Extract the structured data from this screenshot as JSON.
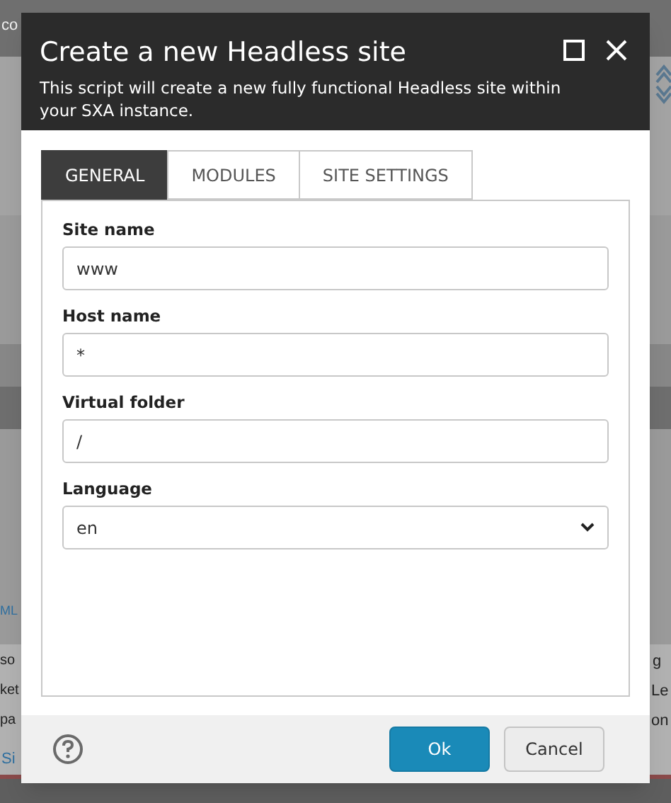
{
  "background": {
    "fragments": [
      {
        "text": "co",
        "kind": "header"
      },
      {
        "text": "ML",
        "kind": "link"
      },
      {
        "text": "so",
        "kind": "left"
      },
      {
        "text": "ket",
        "kind": "left"
      },
      {
        "text": "pa",
        "kind": "left"
      },
      {
        "text": "Si",
        "kind": "link-left"
      },
      {
        "text": "g",
        "kind": "right"
      },
      {
        "text": "Le",
        "kind": "right"
      },
      {
        "text": "on",
        "kind": "right"
      }
    ]
  },
  "dialog": {
    "title": "Create a new Headless site",
    "description": "This script will create a new fully functional Headless site within your SXA instance.",
    "tabs": [
      {
        "label": "GENERAL",
        "selected": true
      },
      {
        "label": "MODULES",
        "selected": false
      },
      {
        "label": "SITE SETTINGS",
        "selected": false
      }
    ],
    "fields": [
      {
        "label": "Site name",
        "kind": "text",
        "value": "www"
      },
      {
        "label": "Host name",
        "kind": "text",
        "value": "*"
      },
      {
        "label": "Virtual folder",
        "kind": "text",
        "value": "/"
      },
      {
        "label": "Language",
        "kind": "select",
        "value": "en"
      }
    ],
    "buttons": [
      {
        "label": "Ok",
        "kind": "primary"
      },
      {
        "label": "Cancel",
        "kind": "secondary"
      }
    ]
  }
}
